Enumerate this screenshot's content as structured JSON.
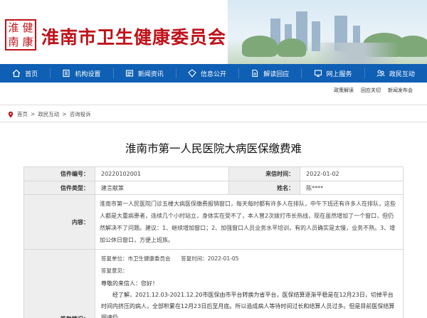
{
  "header": {
    "logo_chars": [
      "淮",
      "健",
      "南",
      "康"
    ],
    "site_title": "淮南市卫生健康委员会"
  },
  "nav": {
    "items": [
      {
        "label": "首页",
        "icon": "home-icon"
      },
      {
        "label": "机构设置",
        "icon": "organization-icon"
      },
      {
        "label": "新闻资讯",
        "icon": "news-icon"
      },
      {
        "label": "信息公开",
        "icon": "info-icon"
      },
      {
        "label": "解读回应",
        "icon": "document-icon"
      },
      {
        "label": "网上服务",
        "icon": "service-icon"
      },
      {
        "label": "政民互动",
        "icon": "interaction-icon"
      }
    ]
  },
  "subnav": {
    "items": [
      "政策解读",
      "回应关切",
      "新闻发布会"
    ]
  },
  "breadcrumb": {
    "home": "首页",
    "sep": ">",
    "level2": "政民互动",
    "level3": "咨询投诉"
  },
  "page": {
    "title": "淮南市第一人民医院大病医保缴费难"
  },
  "detail": {
    "letter_no_label": "信件编号：",
    "letter_no": "20220102001",
    "date_label": "来信时间：",
    "date": "2022-01-02",
    "type_label": "信件类型：",
    "type": "建言献策",
    "name_label": "姓名：",
    "name": "陈****",
    "content_label": "内容：",
    "content": "淮南市第一人民医院门诊五楼大病医保缴费报销窗口，每天每时都有许多人在排队，中午下班还有许多人在排队，这些人都是大重病患者，连续几个小时站立，身体实在受不了，本人曾2次拨打市长热线，现在虽然增加了一个窗口，但仍然解决不了问题。建议：1、继续增加窗口；2、加强窗口人员业务水平培训，有的人员确实是太慢，业务不熟。3、增加公休日窗口，方便上班族。",
    "reply_label": "答复情况：",
    "reply_unit_label": "答复单位：",
    "reply_unit": "市卫生健康委员会",
    "reply_time_label": "答复时间：",
    "reply_time": "2022-01-05",
    "reply_content_label": "答复意见：",
    "reply_greeting": "尊敬的来信人：您好！",
    "reply_body": "经了解，2021.12.03-2021.12.20市医保由市平台转换为省平台，医保结算逐渐平稳是在12月23日，切掉平台时间内挤压的病人，全部积累在12月23日后至月底。所以造成病人等待时间过长和结算人员过多。但是目前医保结算网速仍"
  }
}
